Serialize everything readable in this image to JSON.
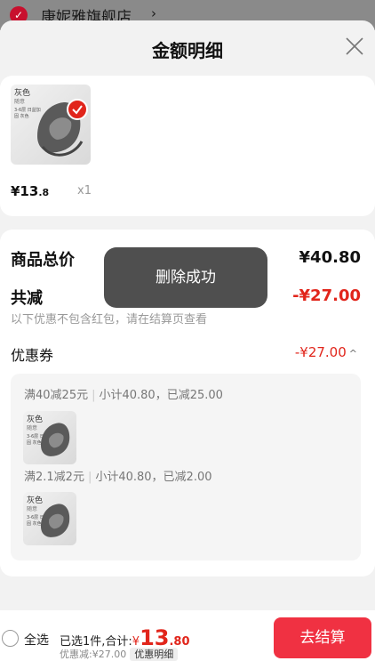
{
  "backdrop": {
    "shop_name": "康妮雅旗舰店",
    "chevron": "›"
  },
  "header": {
    "title": "金额明细"
  },
  "product": {
    "thumb_tag": "灰色",
    "thumb_tag2": "随意",
    "thumb_tag3": "3-6层 日益加固 灰色",
    "price_main": "¥13",
    "price_decimal": ".8",
    "quantity": "x1"
  },
  "summary": {
    "total_label": "商品总价",
    "total_value": "¥40.80",
    "discount_label": "共减",
    "discount_value": "-¥27.00",
    "note": "以下优惠不包含红包，请在结算页查看",
    "coupon_label": "优惠券",
    "coupon_value": "-¥27.00",
    "coupon_toggle": "^",
    "rules": [
      {
        "title": "满40减25元",
        "detail": "小计40.80，已减25.00",
        "thumb_tag": "灰色",
        "thumb_tag2": "随意",
        "thumb_tag3": "3-6层 日益加固 灰色"
      },
      {
        "title": "满2.1减2元",
        "detail": "小计40.80，已减2.00",
        "thumb_tag": "灰色",
        "thumb_tag2": "随意",
        "thumb_tag3": "3-6层 日益加固 灰色"
      }
    ]
  },
  "toast": {
    "text": "删除成功"
  },
  "bottom": {
    "select_all": "全选",
    "selected_text": "已选1件,合计:",
    "currency": "¥",
    "total_int": "13",
    "total_dec": ".80",
    "discount_text": "优惠减:¥27.00",
    "detail_pill": "优惠明细",
    "checkout": "去结算"
  },
  "colors": {
    "accent": "#e1251b",
    "checkout": "#f03142"
  }
}
